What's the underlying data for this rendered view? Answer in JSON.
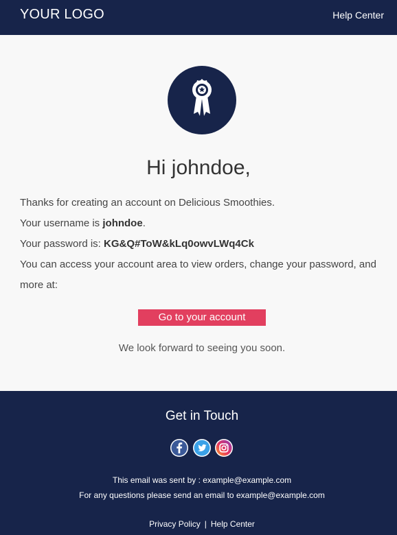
{
  "header": {
    "logo_text": "YOUR LOGO",
    "help_link": "Help Center"
  },
  "main": {
    "badge_icon": "award-ribbon-icon",
    "greeting": "Hi johndoe,",
    "line1": "Thanks for creating an account on Delicious Smoothies.",
    "username_prefix": "Your username is ",
    "username": "johndoe",
    "username_suffix": ".",
    "password_prefix": "Your password is: ",
    "password": "KG&Q#ToW&kLq0owvLWq4Ck",
    "access_text": "You can access your account area to view orders, change your password, and more at:",
    "cta_label": "Go to your account",
    "closing": "We look forward to seeing you soon."
  },
  "footer": {
    "title": "Get in Touch",
    "socials": [
      "facebook-icon",
      "twitter-icon",
      "instagram-icon"
    ],
    "sent_line": "This email was sent by : example@example.com",
    "question_line": "For any questions please send an email to example@example.com",
    "privacy_link": "Privacy Policy",
    "separator": "|",
    "help_link": "Help Center"
  },
  "colors": {
    "navy": "#17244a",
    "accent": "#e23f5f",
    "background": "#f8f8f8"
  }
}
